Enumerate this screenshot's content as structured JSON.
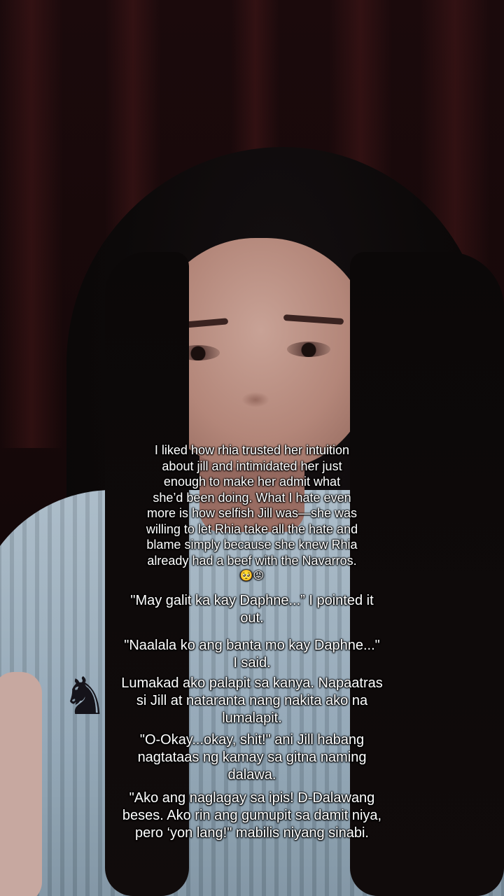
{
  "decorations": {
    "horse_icon": "horse-icon",
    "emoji_icons": "pleading-face-icon angry-face-icon",
    "colors": {
      "background": "#120709",
      "sweater": "#9fb1bf",
      "caption_text": "#ffffff"
    }
  },
  "captions": {
    "main": [
      "I liked how rhia trusted her intuition",
      "about jill  and intimidated her just",
      "enough to make her admit what",
      "she’d been doing. What I hate even",
      "more is how selfish Jill was—she was",
      "willing to let Rhia take all the hate and",
      "blame simply because she knew Rhia",
      "already had a beef with the Navarros."
    ],
    "emojis": "🥺😡",
    "lines": [
      [
        "\"May galit ka kay Daphne...” I pointed it",
        "out."
      ],
      [
        "\"Naalala ko ang banta mo kay Daphne...\"",
        "I said."
      ],
      [
        "Lumakad ako palapit sa kanya. Napaatras",
        "si Jill at nataranta nang nakita ako na",
        "lumalapit."
      ],
      [
        "\"O-Okay...okay, shit!\" ani Jill habang",
        "nagtataas ng kamay sa gitna naming",
        "dalawa."
      ],
      [
        "\"Ako ang naglagay sa ipis! D-Dalawang",
        "beses. Ako rin ang gumupit sa damit niya,",
        "pero ‘yon lang!\" mabilis niyang sinabi."
      ]
    ]
  }
}
